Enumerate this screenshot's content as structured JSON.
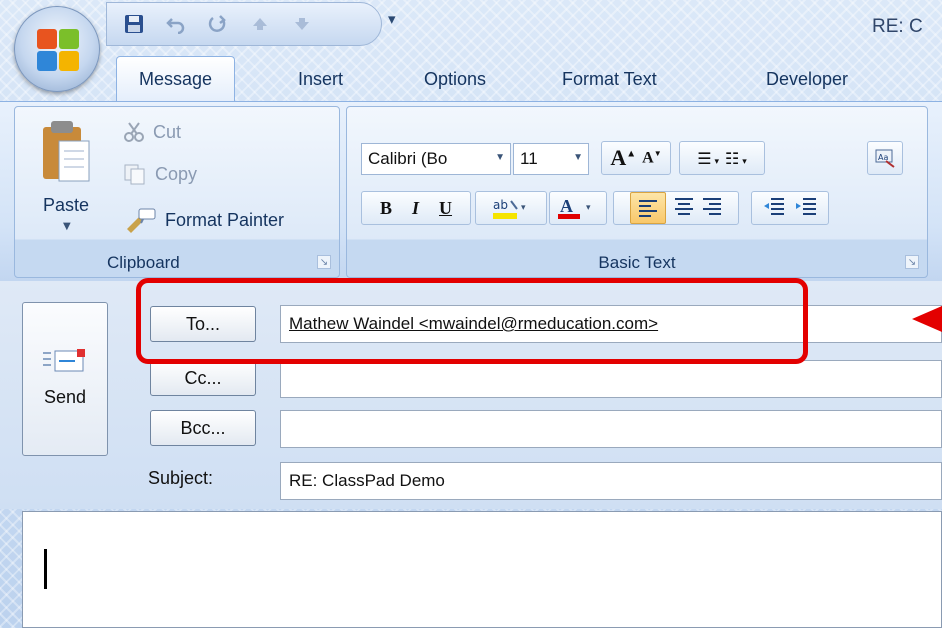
{
  "window": {
    "title": "RE: C"
  },
  "quick_access": {
    "icons": [
      "save-icon",
      "undo-icon",
      "redo-icon",
      "up-arrow-icon",
      "down-arrow-icon"
    ],
    "customize": "▾"
  },
  "tabs": [
    "Message",
    "Insert",
    "Options",
    "Format Text",
    "Developer"
  ],
  "ribbon": {
    "clipboard": {
      "group_label": "Clipboard",
      "paste": "Paste",
      "cut": "Cut",
      "copy": "Copy",
      "format_painter": "Format Painter"
    },
    "basic_text": {
      "group_label": "Basic Text",
      "font_name": "Calibri (Bo",
      "font_size": "11",
      "bold": "B",
      "italic": "I",
      "underline": "U"
    }
  },
  "message": {
    "send_label": "Send",
    "to_button": "To...",
    "cc_button": "Cc...",
    "bcc_button": "Bcc...",
    "to_value": "Mathew Waindel <mwaindel@rmeducation.com>",
    "cc_value": "",
    "bcc_value": "",
    "subject_label": "Subject:",
    "subject_value": "RE: ClassPad Demo"
  },
  "annotation": {
    "highlight_color": "#e30000"
  },
  "colors": {
    "ribbon_bg": "#d3e3f7",
    "tab_text": "#15345f",
    "highlight_yellow": "#f5e400",
    "font_red": "#e00000"
  }
}
